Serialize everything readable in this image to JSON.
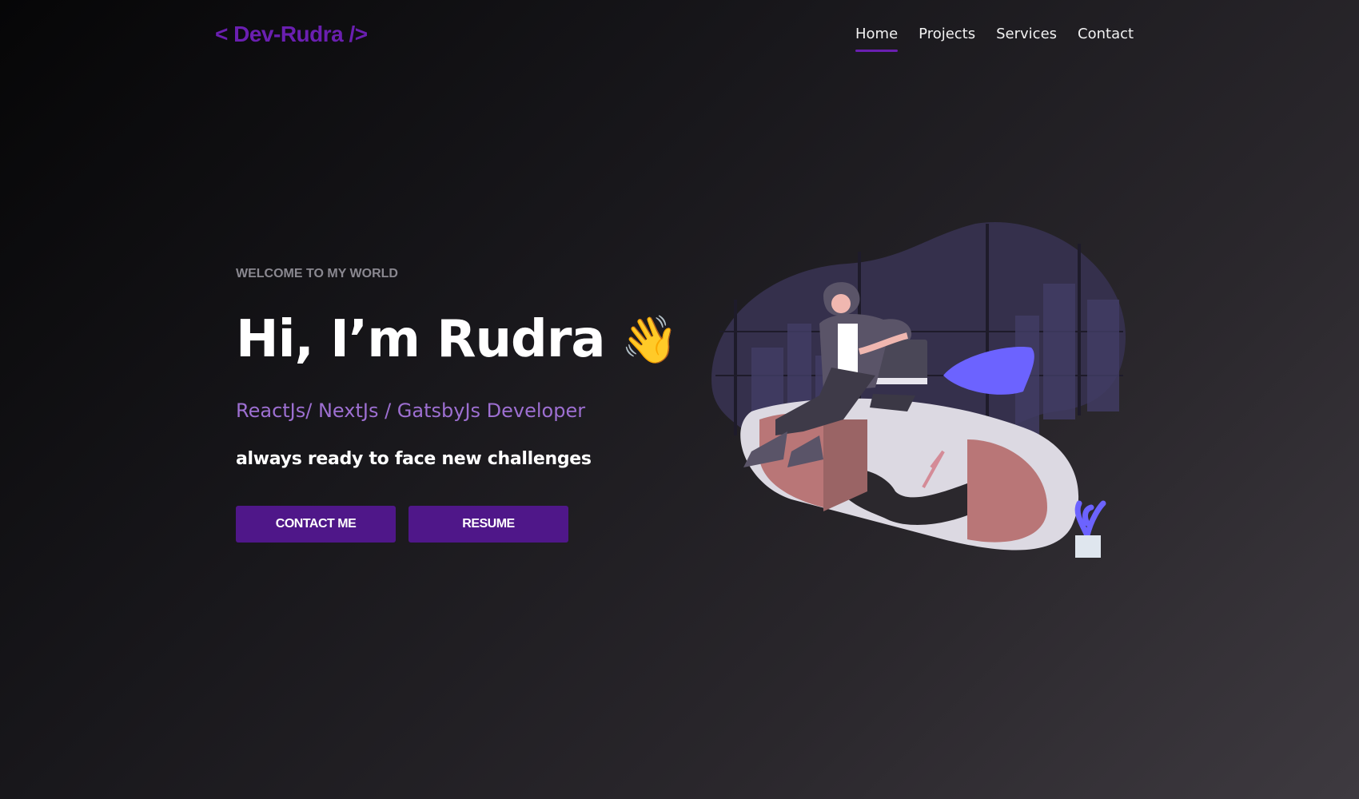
{
  "nav": {
    "logo": "< Dev-Rudra />",
    "items": [
      {
        "label": "Home",
        "active": true
      },
      {
        "label": "Projects",
        "active": false
      },
      {
        "label": "Services",
        "active": false
      },
      {
        "label": "Contact",
        "active": false
      }
    ]
  },
  "hero": {
    "welcome": "WELCOME TO MY WORLD",
    "greeting": "Hi, I’m Rudra",
    "wave_emoji": "👋",
    "role": "ReactJs/ NextJs / GatsbyJs Developer",
    "tagline": "always ready to face new challenges",
    "buttons": {
      "contact": "CONTACT ME",
      "resume": "RESUME"
    }
  },
  "colors": {
    "accent": "#6a1fb0",
    "button": "#4f1789",
    "role_text": "#9d6fd1",
    "illustration_purple": "#6c63ff",
    "desk_red": "#b97677"
  },
  "icons": {
    "illustration": "developer-at-desk-illustration"
  }
}
